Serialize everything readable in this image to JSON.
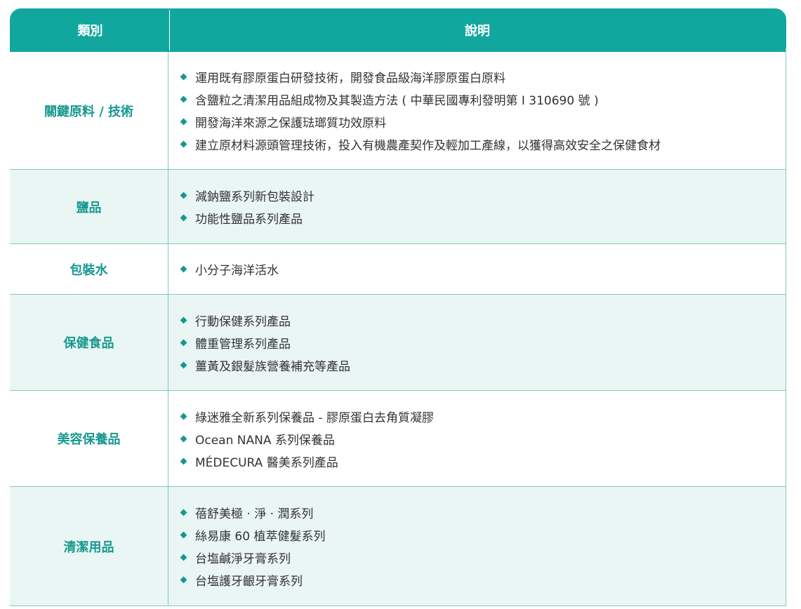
{
  "table": {
    "header": {
      "category_label": "類別",
      "description_label": "說明"
    },
    "rows": [
      {
        "category": "關鍵原料 / 技術",
        "items": [
          "運用既有膠原蛋白研發技術，開發食品級海洋膠原蛋白原料",
          "含鹽粒之清潔用品組成物及其製造方法 ( 中華民國專利發明第 I 310690 號 )",
          "開發海洋來源之保護琺瑯質功效原料",
          "建立原材料源頭管理技術，投入有機農產契作及輕加工產線，以獲得高效安全之保健食材"
        ]
      },
      {
        "category": "鹽品",
        "items": [
          "減鈉鹽系列新包裝設計",
          "功能性鹽品系列產品"
        ]
      },
      {
        "category": "包裝水",
        "items": [
          " 小分子海洋活水"
        ]
      },
      {
        "category": "保健食品",
        "items": [
          "行動保健系列產品",
          "體重管理系列產品",
          "薑黃及銀髮族營養補充等產品"
        ]
      },
      {
        "category": "美容保養品",
        "items": [
          "綠迷雅全新系列保養品 - 膠原蛋白去角質凝膠",
          "Ocean NANA 系列保養品",
          "MÉDECURA 醫美系列產品"
        ]
      },
      {
        "category": "清潔用品",
        "items": [
          "蓓舒美極 ‧ 淨 ‧ 潤系列",
          "絲易康 60 植萃健髮系列",
          "台塩鹹淨牙膏系列",
          "台塩護牙齦牙膏系列"
        ]
      }
    ]
  }
}
